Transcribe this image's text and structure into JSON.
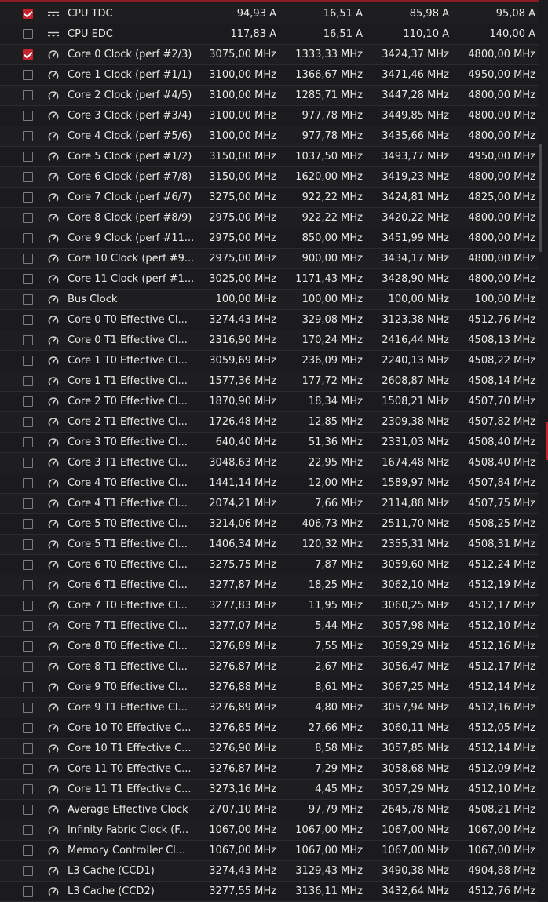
{
  "rows": [
    {
      "type": "current",
      "checked": true,
      "label": "CPU TDC",
      "current": "94,93 A",
      "min": "16,51 A",
      "avg": "85,98 A",
      "max": "95,08 A"
    },
    {
      "type": "current",
      "checked": false,
      "label": "CPU EDC",
      "current": "117,83 A",
      "min": "16,51 A",
      "avg": "110,10 A",
      "max": "140,00 A"
    },
    {
      "type": "clock",
      "checked": true,
      "label": "Core 0 Clock (perf #2/3)",
      "current": "3075,00 MHz",
      "min": "1333,33 MHz",
      "avg": "3424,37 MHz",
      "max": "4800,00 MHz"
    },
    {
      "type": "clock",
      "checked": false,
      "label": "Core 1 Clock (perf #1/1)",
      "current": "3100,00 MHz",
      "min": "1366,67 MHz",
      "avg": "3471,46 MHz",
      "max": "4950,00 MHz"
    },
    {
      "type": "clock",
      "checked": false,
      "label": "Core 2 Clock (perf #4/5)",
      "current": "3100,00 MHz",
      "min": "1285,71 MHz",
      "avg": "3447,28 MHz",
      "max": "4800,00 MHz"
    },
    {
      "type": "clock",
      "checked": false,
      "label": "Core 3 Clock (perf #3/4)",
      "current": "3100,00 MHz",
      "min": "977,78 MHz",
      "avg": "3449,85 MHz",
      "max": "4800,00 MHz"
    },
    {
      "type": "clock",
      "checked": false,
      "label": "Core 4 Clock (perf #5/6)",
      "current": "3100,00 MHz",
      "min": "977,78 MHz",
      "avg": "3435,66 MHz",
      "max": "4800,00 MHz"
    },
    {
      "type": "clock",
      "checked": false,
      "label": "Core 5 Clock (perf #1/2)",
      "current": "3150,00 MHz",
      "min": "1037,50 MHz",
      "avg": "3493,77 MHz",
      "max": "4950,00 MHz"
    },
    {
      "type": "clock",
      "checked": false,
      "label": "Core 6 Clock (perf #7/8)",
      "current": "3150,00 MHz",
      "min": "1620,00 MHz",
      "avg": "3419,23 MHz",
      "max": "4800,00 MHz"
    },
    {
      "type": "clock",
      "checked": false,
      "label": "Core 7 Clock (perf #6/7)",
      "current": "3275,00 MHz",
      "min": "922,22 MHz",
      "avg": "3424,81 MHz",
      "max": "4825,00 MHz"
    },
    {
      "type": "clock",
      "checked": false,
      "label": "Core 8 Clock (perf #8/9)",
      "current": "2975,00 MHz",
      "min": "922,22 MHz",
      "avg": "3420,22 MHz",
      "max": "4800,00 MHz"
    },
    {
      "type": "clock",
      "checked": false,
      "label": "Core 9 Clock (perf #11...",
      "current": "2975,00 MHz",
      "min": "850,00 MHz",
      "avg": "3451,99 MHz",
      "max": "4800,00 MHz"
    },
    {
      "type": "clock",
      "checked": false,
      "label": "Core 10 Clock (perf #9...",
      "current": "2975,00 MHz",
      "min": "900,00 MHz",
      "avg": "3434,17 MHz",
      "max": "4800,00 MHz"
    },
    {
      "type": "clock",
      "checked": false,
      "label": "Core 11 Clock (perf #1...",
      "current": "3025,00 MHz",
      "min": "1171,43 MHz",
      "avg": "3428,90 MHz",
      "max": "4800,00 MHz"
    },
    {
      "type": "clock",
      "checked": false,
      "label": "Bus Clock",
      "current": "100,00 MHz",
      "min": "100,00 MHz",
      "avg": "100,00 MHz",
      "max": "100,00 MHz"
    },
    {
      "type": "clock",
      "checked": false,
      "label": "Core 0 T0 Effective Cl...",
      "current": "3274,43 MHz",
      "min": "329,08 MHz",
      "avg": "3123,38 MHz",
      "max": "4512,76 MHz"
    },
    {
      "type": "clock",
      "checked": false,
      "label": "Core 0 T1 Effective Cl...",
      "current": "2316,90 MHz",
      "min": "170,24 MHz",
      "avg": "2416,44 MHz",
      "max": "4508,13 MHz"
    },
    {
      "type": "clock",
      "checked": false,
      "label": "Core 1 T0 Effective Cl...",
      "current": "3059,69 MHz",
      "min": "236,09 MHz",
      "avg": "2240,13 MHz",
      "max": "4508,22 MHz"
    },
    {
      "type": "clock",
      "checked": false,
      "label": "Core 1 T1 Effective Cl...",
      "current": "1577,36 MHz",
      "min": "177,72 MHz",
      "avg": "2608,87 MHz",
      "max": "4508,14 MHz"
    },
    {
      "type": "clock",
      "checked": false,
      "label": "Core 2 T0 Effective Cl...",
      "current": "1870,90 MHz",
      "min": "18,34 MHz",
      "avg": "1508,21 MHz",
      "max": "4507,70 MHz"
    },
    {
      "type": "clock",
      "checked": false,
      "label": "Core 2 T1 Effective Cl...",
      "current": "1726,48 MHz",
      "min": "12,85 MHz",
      "avg": "2309,38 MHz",
      "max": "4507,82 MHz"
    },
    {
      "type": "clock",
      "checked": false,
      "label": "Core 3 T0 Effective Cl...",
      "current": "640,40 MHz",
      "min": "51,36 MHz",
      "avg": "2331,03 MHz",
      "max": "4508,40 MHz"
    },
    {
      "type": "clock",
      "checked": false,
      "label": "Core 3 T1 Effective Cl...",
      "current": "3048,63 MHz",
      "min": "22,95 MHz",
      "avg": "1674,48 MHz",
      "max": "4508,40 MHz"
    },
    {
      "type": "clock",
      "checked": false,
      "label": "Core 4 T0 Effective Cl...",
      "current": "1441,14 MHz",
      "min": "12,00 MHz",
      "avg": "1589,97 MHz",
      "max": "4507,84 MHz"
    },
    {
      "type": "clock",
      "checked": false,
      "label": "Core 4 T1 Effective Cl...",
      "current": "2074,21 MHz",
      "min": "7,66 MHz",
      "avg": "2114,88 MHz",
      "max": "4507,75 MHz"
    },
    {
      "type": "clock",
      "checked": false,
      "label": "Core 5 T0 Effective Cl...",
      "current": "3214,06 MHz",
      "min": "406,73 MHz",
      "avg": "2511,70 MHz",
      "max": "4508,25 MHz"
    },
    {
      "type": "clock",
      "checked": false,
      "label": "Core 5 T1 Effective Cl...",
      "current": "1406,34 MHz",
      "min": "120,32 MHz",
      "avg": "2355,31 MHz",
      "max": "4508,31 MHz"
    },
    {
      "type": "clock",
      "checked": false,
      "label": "Core 6 T0 Effective Cl...",
      "current": "3275,75 MHz",
      "min": "7,87 MHz",
      "avg": "3059,60 MHz",
      "max": "4512,24 MHz"
    },
    {
      "type": "clock",
      "checked": false,
      "label": "Core 6 T1 Effective Cl...",
      "current": "3277,87 MHz",
      "min": "18,25 MHz",
      "avg": "3062,10 MHz",
      "max": "4512,19 MHz"
    },
    {
      "type": "clock",
      "checked": false,
      "label": "Core 7 T0 Effective Cl...",
      "current": "3277,83 MHz",
      "min": "11,95 MHz",
      "avg": "3060,25 MHz",
      "max": "4512,17 MHz"
    },
    {
      "type": "clock",
      "checked": false,
      "label": "Core 7 T1 Effective Cl...",
      "current": "3277,07 MHz",
      "min": "5,44 MHz",
      "avg": "3057,98 MHz",
      "max": "4512,10 MHz"
    },
    {
      "type": "clock",
      "checked": false,
      "label": "Core 8 T0 Effective Cl...",
      "current": "3276,89 MHz",
      "min": "7,55 MHz",
      "avg": "3059,29 MHz",
      "max": "4512,16 MHz"
    },
    {
      "type": "clock",
      "checked": false,
      "label": "Core 8 T1 Effective Cl...",
      "current": "3276,87 MHz",
      "min": "2,67 MHz",
      "avg": "3056,47 MHz",
      "max": "4512,17 MHz"
    },
    {
      "type": "clock",
      "checked": false,
      "label": "Core 9 T0 Effective Cl...",
      "current": "3276,88 MHz",
      "min": "8,61 MHz",
      "avg": "3067,25 MHz",
      "max": "4512,14 MHz"
    },
    {
      "type": "clock",
      "checked": false,
      "label": "Core 9 T1 Effective Cl...",
      "current": "3276,89 MHz",
      "min": "4,80 MHz",
      "avg": "3057,94 MHz",
      "max": "4512,16 MHz"
    },
    {
      "type": "clock",
      "checked": false,
      "label": "Core 10 T0 Effective C...",
      "current": "3276,85 MHz",
      "min": "27,66 MHz",
      "avg": "3060,11 MHz",
      "max": "4512,05 MHz"
    },
    {
      "type": "clock",
      "checked": false,
      "label": "Core 10 T1 Effective C...",
      "current": "3276,90 MHz",
      "min": "8,58 MHz",
      "avg": "3057,85 MHz",
      "max": "4512,14 MHz"
    },
    {
      "type": "clock",
      "checked": false,
      "label": "Core 11 T0 Effective C...",
      "current": "3276,87 MHz",
      "min": "7,29 MHz",
      "avg": "3058,68 MHz",
      "max": "4512,09 MHz"
    },
    {
      "type": "clock",
      "checked": false,
      "label": "Core 11 T1 Effective C...",
      "current": "3273,16 MHz",
      "min": "4,45 MHz",
      "avg": "3057,29 MHz",
      "max": "4512,10 MHz"
    },
    {
      "type": "clock",
      "checked": false,
      "label": "Average Effective Clock",
      "current": "2707,10 MHz",
      "min": "97,79 MHz",
      "avg": "2645,78 MHz",
      "max": "4508,21 MHz"
    },
    {
      "type": "clock",
      "checked": false,
      "label": "Infinity Fabric Clock (F...",
      "current": "1067,00 MHz",
      "min": "1067,00 MHz",
      "avg": "1067,00 MHz",
      "max": "1067,00 MHz"
    },
    {
      "type": "clock",
      "checked": false,
      "label": "Memory Controller Cl...",
      "current": "1067,00 MHz",
      "min": "1067,00 MHz",
      "avg": "1067,00 MHz",
      "max": "1067,00 MHz"
    },
    {
      "type": "clock",
      "checked": false,
      "label": "L3 Cache (CCD1)",
      "current": "3274,43 MHz",
      "min": "3129,43 MHz",
      "avg": "3490,38 MHz",
      "max": "4904,88 MHz"
    },
    {
      "type": "clock",
      "checked": false,
      "label": "L3 Cache (CCD2)",
      "current": "3277,55 MHz",
      "min": "3136,11 MHz",
      "avg": "3432,64 MHz",
      "max": "4512,76 MHz"
    }
  ],
  "icons": {
    "current": "current-icon",
    "clock": "gauge-icon"
  },
  "colors": {
    "accent": "#c2232e",
    "background": "#1b1b1d",
    "text": "#e8e8e8"
  }
}
